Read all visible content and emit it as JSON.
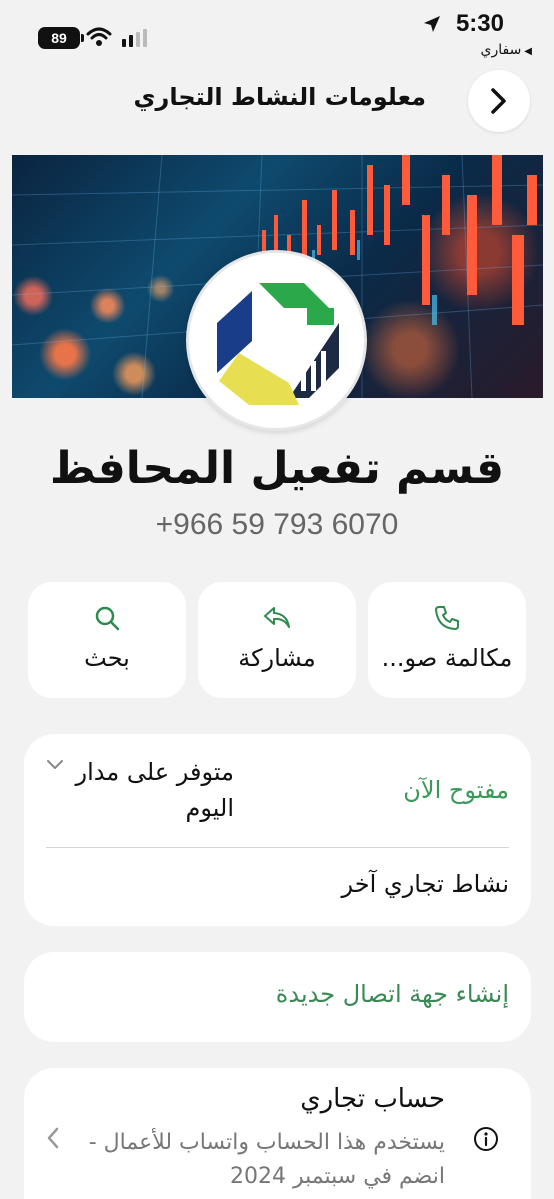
{
  "status_bar": {
    "time": "5:30",
    "battery": "89",
    "back_app": "سفاري"
  },
  "header": {
    "title": "معلومات النشاط التجاري"
  },
  "business": {
    "name": "قسم تفعيل المحافظ",
    "phone": "+966 59 793 6070"
  },
  "actions": [
    {
      "label": "مكالمة صو...",
      "icon": "phone-icon"
    },
    {
      "label": "مشاركة",
      "icon": "share-icon"
    },
    {
      "label": "بحث",
      "icon": "search-icon"
    }
  ],
  "hours": {
    "status": "مفتوح الآن",
    "availability": "متوفر على مدار اليوم"
  },
  "other_business": "نشاط تجاري آخر",
  "create_contact": "إنشاء جهة اتصال جديدة",
  "account": {
    "title": "حساب تجاري",
    "description": "يستخدم هذا الحساب واتساب للأعمال - انضم في سبتمبر 2024"
  },
  "colors": {
    "accent_green": "#3b9a5a",
    "icon_green": "#2e8b4e",
    "background": "#f2f2f2"
  }
}
